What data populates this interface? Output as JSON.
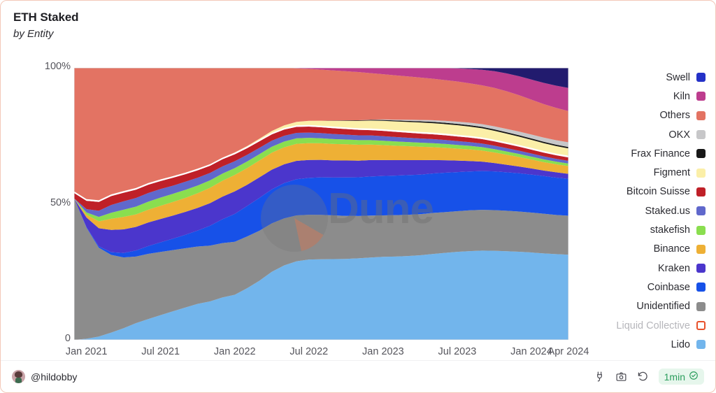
{
  "header": {
    "title": "ETH Staked",
    "subtitle": "by Entity"
  },
  "footer": {
    "author_handle": "@hildobby",
    "avatar_icon": "avatar-icon",
    "actions": [
      {
        "icon": "embed-plug-icon",
        "label": "Embed"
      },
      {
        "icon": "camera-icon",
        "label": "Screenshot"
      },
      {
        "icon": "refresh-icon",
        "label": "Refresh"
      }
    ],
    "refresh_badge": {
      "label": "1min",
      "icon": "check-circle-icon",
      "color": "#2a9d5c"
    }
  },
  "watermark": {
    "text": "Dune"
  },
  "chart_data": {
    "type": "area",
    "title": "ETH Staked",
    "subtitle": "by Entity",
    "xlabel": "",
    "ylabel": "",
    "stacked": true,
    "normalized": true,
    "grid": false,
    "legend_position": "right",
    "ylim": [
      0,
      100
    ],
    "ytick_labels": [
      "100%",
      "50%",
      "0"
    ],
    "ytick_values": [
      100,
      50,
      0
    ],
    "xtick_labels": [
      "Jan 2021",
      "Jul 2021",
      "Jan 2022",
      "Jul 2022",
      "Jan 2023",
      "Jul 2023",
      "Jan 2024",
      "Apr 2024"
    ],
    "x": [
      "2020-12-01",
      "2021-01-01",
      "2021-02-01",
      "2021-03-01",
      "2021-04-01",
      "2021-05-01",
      "2021-06-01",
      "2021-07-01",
      "2021-08-01",
      "2021-09-01",
      "2021-10-01",
      "2021-11-01",
      "2021-12-01",
      "2022-01-01",
      "2022-02-01",
      "2022-03-01",
      "2022-04-01",
      "2022-05-01",
      "2022-06-01",
      "2022-07-01",
      "2022-08-01",
      "2022-09-01",
      "2022-10-01",
      "2022-11-01",
      "2022-12-01",
      "2023-01-01",
      "2023-02-01",
      "2023-03-01",
      "2023-04-01",
      "2023-05-01",
      "2023-06-01",
      "2023-07-01",
      "2023-08-01",
      "2023-09-01",
      "2023-10-01",
      "2023-11-01",
      "2023-12-01",
      "2024-01-01",
      "2024-02-01",
      "2024-03-01",
      "2024-04-01"
    ],
    "series": [
      {
        "name": "Lido",
        "color": "#72b5ec",
        "values": [
          0,
          0.4,
          1.2,
          2.6,
          4.2,
          6.0,
          7.5,
          9.0,
          10.5,
          12.0,
          13.5,
          14.5,
          16.0,
          17.0,
          19.5,
          22.5,
          26.0,
          28.5,
          30.0,
          30.5,
          30.5,
          30.5,
          30.5,
          30.8,
          31.0,
          31.2,
          31.2,
          31.3,
          31.5,
          31.8,
          32.0,
          32.2,
          32.2,
          32.2,
          32.0,
          31.8,
          31.5,
          31.3,
          31.0,
          30.8,
          30.5
        ]
      },
      {
        "name": "Unidentified",
        "color": "#8c8c8c",
        "values": [
          52.0,
          40.0,
          32.0,
          28.0,
          25.5,
          24.0,
          23.5,
          23.0,
          22.5,
          22.0,
          21.5,
          21.0,
          20.5,
          20.0,
          19.5,
          19.0,
          18.5,
          18.0,
          17.5,
          17.0,
          16.8,
          16.5,
          16.2,
          16.0,
          15.8,
          15.6,
          15.5,
          15.4,
          15.3,
          15.2,
          15.0,
          14.9,
          14.8,
          14.7,
          14.6,
          14.5,
          14.4,
          14.3,
          14.2,
          14.1,
          14.0
        ]
      },
      {
        "name": "Coinbase",
        "color": "#1751e8",
        "values": [
          0.0,
          0.2,
          0.5,
          1.0,
          1.6,
          2.2,
          2.8,
          3.5,
          4.2,
          5.0,
          6.0,
          7.5,
          9.0,
          10.5,
          11.5,
          12.5,
          13.0,
          13.5,
          13.8,
          14.0,
          14.2,
          14.3,
          14.5,
          14.6,
          14.7,
          14.8,
          14.8,
          14.8,
          14.7,
          14.6,
          14.5,
          14.3,
          14.1,
          14.0,
          13.9,
          13.8,
          13.7,
          13.6,
          13.5,
          13.4,
          13.2
        ]
      },
      {
        "name": "Kraken",
        "color": "#4b36cc",
        "values": [
          0.0,
          3.5,
          6.5,
          8.0,
          8.5,
          8.5,
          8.5,
          8.5,
          8.5,
          8.5,
          8.5,
          8.5,
          8.5,
          8.5,
          8.0,
          7.8,
          7.5,
          7.2,
          7.0,
          6.8,
          6.6,
          6.5,
          6.4,
          6.3,
          6.2,
          6.0,
          5.8,
          5.6,
          5.4,
          5.0,
          4.6,
          4.2,
          3.8,
          3.4,
          3.0,
          2.7,
          2.4,
          2.2,
          2.0,
          1.9,
          1.8
        ]
      },
      {
        "name": "Binance",
        "color": "#eeb035",
        "values": [
          0.0,
          1.0,
          2.5,
          4.0,
          4.5,
          4.5,
          4.6,
          4.8,
          5.0,
          5.2,
          5.5,
          5.8,
          6.0,
          6.2,
          6.3,
          6.4,
          6.5,
          6.5,
          6.5,
          6.4,
          6.3,
          6.2,
          6.1,
          6.0,
          5.8,
          5.6,
          5.4,
          5.2,
          5.0,
          4.8,
          4.6,
          4.4,
          4.2,
          4.0,
          3.8,
          3.6,
          3.4,
          3.2,
          3.0,
          2.9,
          2.8
        ]
      },
      {
        "name": "stakefish",
        "color": "#8ade4f",
        "values": [
          0.0,
          0.8,
          1.6,
          2.2,
          2.6,
          2.8,
          2.9,
          3.0,
          3.0,
          3.0,
          2.9,
          2.8,
          2.7,
          2.6,
          2.5,
          2.4,
          2.3,
          2.2,
          2.1,
          2.0,
          1.9,
          1.85,
          1.8,
          1.75,
          1.7,
          1.65,
          1.6,
          1.55,
          1.5,
          1.45,
          1.4,
          1.35,
          1.3,
          1.25,
          1.2,
          1.15,
          1.1,
          1.05,
          1.0,
          0.95,
          0.9
        ]
      },
      {
        "name": "Staked.us",
        "color": "#6068cc",
        "values": [
          0.0,
          1.2,
          2.2,
          2.8,
          3.0,
          3.1,
          3.1,
          3.1,
          3.0,
          3.0,
          2.9,
          2.8,
          2.7,
          2.6,
          2.5,
          2.4,
          2.3,
          2.2,
          2.1,
          2.0,
          1.95,
          1.9,
          1.85,
          1.8,
          1.75,
          1.7,
          1.65,
          1.6,
          1.55,
          1.5,
          1.45,
          1.4,
          1.35,
          1.3,
          1.25,
          1.2,
          1.15,
          1.1,
          1.05,
          1.0,
          0.95
        ]
      },
      {
        "name": "Bitcoin Suisse",
        "color": "#bf2028",
        "values": [
          2.0,
          3.0,
          3.2,
          3.2,
          3.1,
          3.0,
          3.0,
          2.9,
          2.9,
          2.8,
          2.8,
          2.7,
          2.7,
          2.6,
          2.5,
          2.5,
          2.4,
          2.4,
          2.3,
          2.3,
          2.2,
          2.2,
          2.1,
          2.1,
          2.0,
          2.0,
          1.95,
          1.9,
          1.85,
          1.8,
          1.75,
          1.7,
          1.65,
          1.6,
          1.55,
          1.5,
          1.45,
          1.4,
          1.35,
          1.3,
          1.25
        ]
      },
      {
        "name": "Liquid Collective",
        "color": "#ffffff",
        "values": [
          0.6,
          0.6,
          0.6,
          0.6,
          0.6,
          0.6,
          0.6,
          0.6,
          0.6,
          0.6,
          0.6,
          0.6,
          0.6,
          0.6,
          0.6,
          0.6,
          0.6,
          0.6,
          0.6,
          0.6,
          0.6,
          0.6,
          0.6,
          0.6,
          0.6,
          0.6,
          0.6,
          0.6,
          0.6,
          0.6,
          0.6,
          0.6,
          0.6,
          0.6,
          0.6,
          0.6,
          0.6,
          0.6,
          0.6,
          0.6,
          0.6
        ],
        "deselected": true
      },
      {
        "name": "Figment",
        "color": "#fbefa8",
        "values": [
          0.0,
          0.0,
          0.0,
          0.0,
          0.0,
          0.0,
          0.0,
          0.0,
          0.0,
          0.0,
          0.0,
          0.0,
          0.0,
          0.1,
          0.2,
          0.4,
          0.7,
          1.0,
          1.3,
          1.6,
          1.9,
          2.2,
          2.5,
          2.8,
          3.0,
          3.2,
          3.3,
          3.4,
          3.5,
          3.5,
          3.5,
          3.5,
          3.4,
          3.3,
          3.2,
          3.1,
          3.0,
          2.9,
          2.8,
          2.7,
          2.6
        ]
      },
      {
        "name": "Frax Finance",
        "color": "#181818",
        "values": [
          0.0,
          0.0,
          0.0,
          0.0,
          0.0,
          0.0,
          0.0,
          0.0,
          0.0,
          0.0,
          0.0,
          0.0,
          0.0,
          0.0,
          0.0,
          0.0,
          0.0,
          0.0,
          0.0,
          0.0,
          0.0,
          0.1,
          0.15,
          0.2,
          0.25,
          0.3,
          0.35,
          0.4,
          0.45,
          0.5,
          0.5,
          0.5,
          0.5,
          0.5,
          0.5,
          0.5,
          0.5,
          0.5,
          0.5,
          0.5,
          0.5
        ]
      },
      {
        "name": "OKX",
        "color": "#c7c7c9",
        "values": [
          0.0,
          0.0,
          0.0,
          0.0,
          0.0,
          0.0,
          0.0,
          0.0,
          0.0,
          0.0,
          0.0,
          0.0,
          0.0,
          0.0,
          0.0,
          0.0,
          0.0,
          0.0,
          0.0,
          0.0,
          0.0,
          0.0,
          0.0,
          0.0,
          0.1,
          0.2,
          0.3,
          0.4,
          0.5,
          0.6,
          0.7,
          0.8,
          0.9,
          1.0,
          1.1,
          1.2,
          1.3,
          1.4,
          1.5,
          1.6,
          1.7
        ]
      },
      {
        "name": "Others",
        "color": "#e37363",
        "values": [
          45.4,
          47.3,
          47.7,
          45.6,
          44.4,
          43.3,
          41.5,
          40.6,
          39.8,
          38.9,
          37.8,
          36.3,
          33.9,
          31.9,
          29.5,
          26.9,
          24.1,
          22.0,
          20.4,
          19.7,
          19.3,
          18.9,
          18.5,
          18.2,
          17.5,
          17.0,
          16.6,
          16.2,
          15.8,
          15.4,
          15.0,
          14.7,
          14.3,
          14.0,
          13.8,
          13.5,
          13.0,
          12.5,
          12.0,
          11.6,
          11.2
        ]
      },
      {
        "name": "Kiln",
        "color": "#bd3d8e",
        "values": [
          0.0,
          0.0,
          0.0,
          0.0,
          0.0,
          0.0,
          0.0,
          0.0,
          0.0,
          0.0,
          0.0,
          0.0,
          0.0,
          0.0,
          0.0,
          0.0,
          0.0,
          0.0,
          0.2,
          0.4,
          0.7,
          1.0,
          1.3,
          1.6,
          2.0,
          2.4,
          2.8,
          3.2,
          3.6,
          4.0,
          4.4,
          4.8,
          5.2,
          5.6,
          6.0,
          6.4,
          6.8,
          7.2,
          7.6,
          8.0,
          8.3
        ]
      },
      {
        "name": "Swell",
        "color": "#221b6e",
        "values": [
          0.0,
          0.0,
          0.0,
          0.0,
          0.0,
          0.0,
          0.0,
          0.0,
          0.0,
          0.0,
          0.0,
          0.0,
          0.0,
          0.0,
          0.0,
          0.0,
          0.0,
          0.0,
          0.0,
          0.0,
          0.0,
          0.0,
          0.0,
          0.0,
          0.0,
          0.0,
          0.0,
          0.0,
          0.0,
          0.0,
          0.1,
          0.2,
          0.4,
          0.7,
          1.2,
          2.0,
          3.0,
          4.2,
          5.4,
          6.4,
          7.2
        ]
      }
    ],
    "legend": [
      {
        "label": "Swell",
        "color": "#2431c7",
        "selected": true
      },
      {
        "label": "Kiln",
        "color": "#bd3d8e",
        "selected": true
      },
      {
        "label": "Others",
        "color": "#e37363",
        "selected": true
      },
      {
        "label": "OKX",
        "color": "#c7c7c9",
        "selected": true
      },
      {
        "label": "Frax Finance",
        "color": "#181818",
        "selected": true
      },
      {
        "label": "Figment",
        "color": "#fbefa8",
        "selected": true
      },
      {
        "label": "Bitcoin Suisse",
        "color": "#bf2028",
        "selected": true
      },
      {
        "label": "Staked.us",
        "color": "#6068cc",
        "selected": true
      },
      {
        "label": "stakefish",
        "color": "#8ade4f",
        "selected": true
      },
      {
        "label": "Binance",
        "color": "#eeb035",
        "selected": true
      },
      {
        "label": "Kraken",
        "color": "#4b36cc",
        "selected": true
      },
      {
        "label": "Coinbase",
        "color": "#1751e8",
        "selected": true
      },
      {
        "label": "Unidentified",
        "color": "#8c8c8c",
        "selected": true
      },
      {
        "label": "Liquid Collective",
        "color": "#e8512b",
        "selected": false
      },
      {
        "label": "Lido",
        "color": "#72b5ec",
        "selected": true
      }
    ]
  }
}
